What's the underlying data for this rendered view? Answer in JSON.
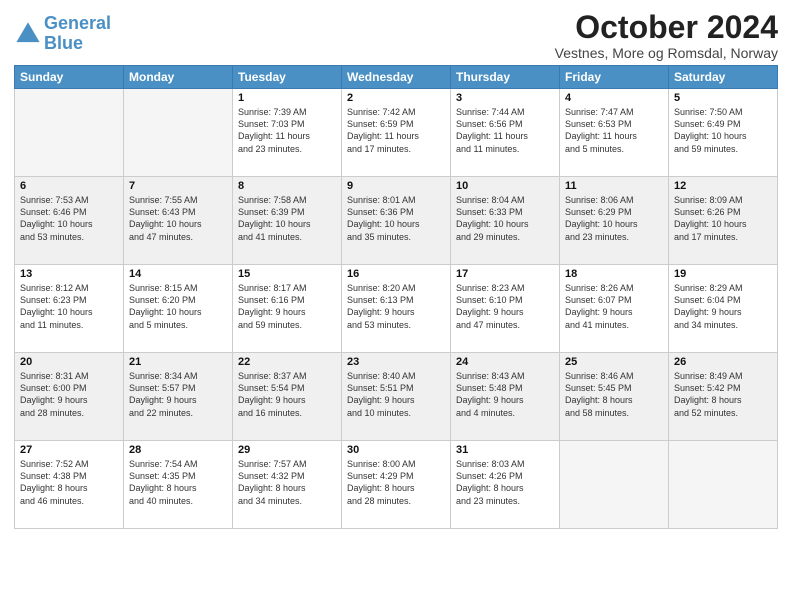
{
  "logo": {
    "line1": "General",
    "line2": "Blue"
  },
  "title": "October 2024",
  "subtitle": "Vestnes, More og Romsdal, Norway",
  "headers": [
    "Sunday",
    "Monday",
    "Tuesday",
    "Wednesday",
    "Thursday",
    "Friday",
    "Saturday"
  ],
  "weeks": [
    [
      {
        "day": "",
        "info": "",
        "empty": true
      },
      {
        "day": "",
        "info": "",
        "empty": true
      },
      {
        "day": "1",
        "info": "Sunrise: 7:39 AM\nSunset: 7:03 PM\nDaylight: 11 hours\nand 23 minutes."
      },
      {
        "day": "2",
        "info": "Sunrise: 7:42 AM\nSunset: 6:59 PM\nDaylight: 11 hours\nand 17 minutes."
      },
      {
        "day": "3",
        "info": "Sunrise: 7:44 AM\nSunset: 6:56 PM\nDaylight: 11 hours\nand 11 minutes."
      },
      {
        "day": "4",
        "info": "Sunrise: 7:47 AM\nSunset: 6:53 PM\nDaylight: 11 hours\nand 5 minutes."
      },
      {
        "day": "5",
        "info": "Sunrise: 7:50 AM\nSunset: 6:49 PM\nDaylight: 10 hours\nand 59 minutes."
      }
    ],
    [
      {
        "day": "6",
        "info": "Sunrise: 7:53 AM\nSunset: 6:46 PM\nDaylight: 10 hours\nand 53 minutes."
      },
      {
        "day": "7",
        "info": "Sunrise: 7:55 AM\nSunset: 6:43 PM\nDaylight: 10 hours\nand 47 minutes."
      },
      {
        "day": "8",
        "info": "Sunrise: 7:58 AM\nSunset: 6:39 PM\nDaylight: 10 hours\nand 41 minutes."
      },
      {
        "day": "9",
        "info": "Sunrise: 8:01 AM\nSunset: 6:36 PM\nDaylight: 10 hours\nand 35 minutes."
      },
      {
        "day": "10",
        "info": "Sunrise: 8:04 AM\nSunset: 6:33 PM\nDaylight: 10 hours\nand 29 minutes."
      },
      {
        "day": "11",
        "info": "Sunrise: 8:06 AM\nSunset: 6:29 PM\nDaylight: 10 hours\nand 23 minutes."
      },
      {
        "day": "12",
        "info": "Sunrise: 8:09 AM\nSunset: 6:26 PM\nDaylight: 10 hours\nand 17 minutes."
      }
    ],
    [
      {
        "day": "13",
        "info": "Sunrise: 8:12 AM\nSunset: 6:23 PM\nDaylight: 10 hours\nand 11 minutes."
      },
      {
        "day": "14",
        "info": "Sunrise: 8:15 AM\nSunset: 6:20 PM\nDaylight: 10 hours\nand 5 minutes."
      },
      {
        "day": "15",
        "info": "Sunrise: 8:17 AM\nSunset: 6:16 PM\nDaylight: 9 hours\nand 59 minutes."
      },
      {
        "day": "16",
        "info": "Sunrise: 8:20 AM\nSunset: 6:13 PM\nDaylight: 9 hours\nand 53 minutes."
      },
      {
        "day": "17",
        "info": "Sunrise: 8:23 AM\nSunset: 6:10 PM\nDaylight: 9 hours\nand 47 minutes."
      },
      {
        "day": "18",
        "info": "Sunrise: 8:26 AM\nSunset: 6:07 PM\nDaylight: 9 hours\nand 41 minutes."
      },
      {
        "day": "19",
        "info": "Sunrise: 8:29 AM\nSunset: 6:04 PM\nDaylight: 9 hours\nand 34 minutes."
      }
    ],
    [
      {
        "day": "20",
        "info": "Sunrise: 8:31 AM\nSunset: 6:00 PM\nDaylight: 9 hours\nand 28 minutes."
      },
      {
        "day": "21",
        "info": "Sunrise: 8:34 AM\nSunset: 5:57 PM\nDaylight: 9 hours\nand 22 minutes."
      },
      {
        "day": "22",
        "info": "Sunrise: 8:37 AM\nSunset: 5:54 PM\nDaylight: 9 hours\nand 16 minutes."
      },
      {
        "day": "23",
        "info": "Sunrise: 8:40 AM\nSunset: 5:51 PM\nDaylight: 9 hours\nand 10 minutes."
      },
      {
        "day": "24",
        "info": "Sunrise: 8:43 AM\nSunset: 5:48 PM\nDaylight: 9 hours\nand 4 minutes."
      },
      {
        "day": "25",
        "info": "Sunrise: 8:46 AM\nSunset: 5:45 PM\nDaylight: 8 hours\nand 58 minutes."
      },
      {
        "day": "26",
        "info": "Sunrise: 8:49 AM\nSunset: 5:42 PM\nDaylight: 8 hours\nand 52 minutes."
      }
    ],
    [
      {
        "day": "27",
        "info": "Sunrise: 7:52 AM\nSunset: 4:38 PM\nDaylight: 8 hours\nand 46 minutes."
      },
      {
        "day": "28",
        "info": "Sunrise: 7:54 AM\nSunset: 4:35 PM\nDaylight: 8 hours\nand 40 minutes."
      },
      {
        "day": "29",
        "info": "Sunrise: 7:57 AM\nSunset: 4:32 PM\nDaylight: 8 hours\nand 34 minutes."
      },
      {
        "day": "30",
        "info": "Sunrise: 8:00 AM\nSunset: 4:29 PM\nDaylight: 8 hours\nand 28 minutes."
      },
      {
        "day": "31",
        "info": "Sunrise: 8:03 AM\nSunset: 4:26 PM\nDaylight: 8 hours\nand 23 minutes."
      },
      {
        "day": "",
        "info": "",
        "empty": true
      },
      {
        "day": "",
        "info": "",
        "empty": true
      }
    ]
  ]
}
